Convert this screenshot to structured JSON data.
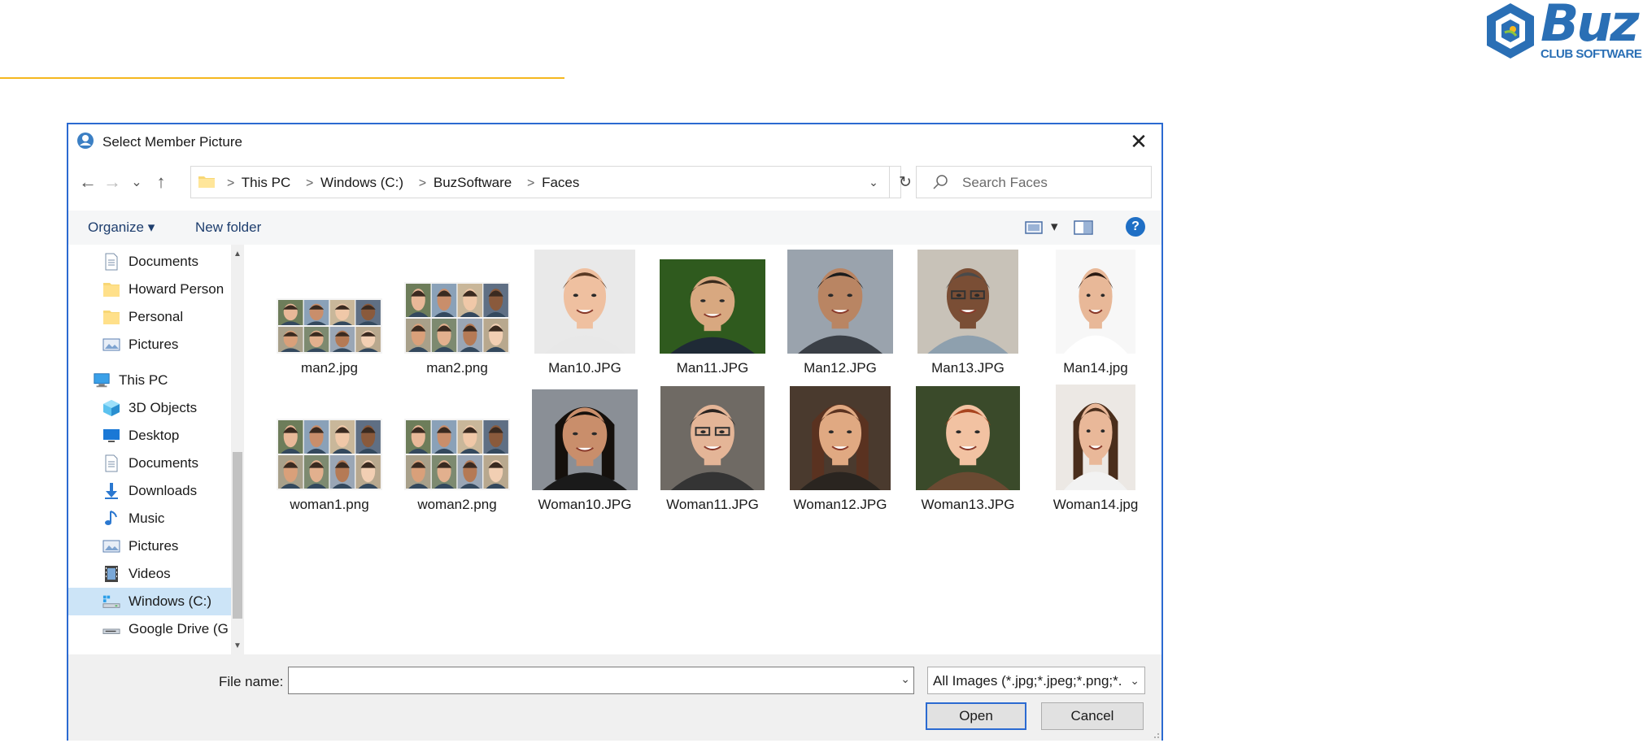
{
  "logo": {
    "word": "Buz",
    "sub": "CLUB SOFTWARE"
  },
  "dialog": {
    "title": "Select Member Picture",
    "close_glyph": "✕"
  },
  "nav": {
    "back": "←",
    "forward": "→",
    "recent": "⌄",
    "up": "↑",
    "breadcrumbs": [
      "This PC",
      "Windows (C:)",
      "BuzSoftware",
      "Faces"
    ],
    "sep": ">",
    "dropdown": "⌄",
    "refresh": "↻",
    "search_placeholder": "Search Faces"
  },
  "toolbar": {
    "organize_label": "Organize ▾",
    "new_folder_label": "New folder",
    "view_caret": "▾",
    "help": "?"
  },
  "sidebar": {
    "items": [
      {
        "label": "Documents",
        "icon": "documents-icon"
      },
      {
        "label": "Howard Person",
        "icon": "folder-icon"
      },
      {
        "label": "Personal",
        "icon": "folder-icon"
      },
      {
        "label": "Pictures",
        "icon": "pictures-icon"
      },
      {
        "label": "This PC",
        "icon": "this-pc-icon"
      },
      {
        "label": "3D Objects",
        "icon": "3d-objects-icon"
      },
      {
        "label": "Desktop",
        "icon": "desktop-icon"
      },
      {
        "label": "Documents",
        "icon": "documents-icon"
      },
      {
        "label": "Downloads",
        "icon": "downloads-icon"
      },
      {
        "label": "Music",
        "icon": "music-icon"
      },
      {
        "label": "Pictures",
        "icon": "pictures-icon"
      },
      {
        "label": "Videos",
        "icon": "videos-icon"
      },
      {
        "label": "Windows (C:)",
        "icon": "drive-icon",
        "selected": true
      },
      {
        "label": "Google Drive (G",
        "icon": "network-drive-icon"
      }
    ],
    "scroll_up": "▲",
    "scroll_down": "▼"
  },
  "files": [
    {
      "name": "man2.jpg"
    },
    {
      "name": "man2.png"
    },
    {
      "name": "Man10.JPG"
    },
    {
      "name": "Man11.JPG"
    },
    {
      "name": "Man12.JPG"
    },
    {
      "name": "Man13.JPG"
    },
    {
      "name": "Man14.jpg"
    },
    {
      "name": "woman1.png"
    },
    {
      "name": "woman2.png"
    },
    {
      "name": "Woman10.JPG"
    },
    {
      "name": "Woman11.JPG"
    },
    {
      "name": "Woman12.JPG"
    },
    {
      "name": "Woman13.JPG"
    },
    {
      "name": "Woman14.jpg"
    }
  ],
  "footer": {
    "file_name_label": "File name:",
    "file_name_value": "",
    "file_name_dropdown": "⌄",
    "filter_label": "All Images (*.jpg;*.jpeg;*.png;*.",
    "filter_caret": "⌄",
    "open_label": "Open",
    "cancel_label": "Cancel"
  },
  "colors": {
    "accent_line": "#f5b81f",
    "dialog_border": "#2b6ad1",
    "brand": "#2a6fb5",
    "selection": "#cce4f7"
  }
}
